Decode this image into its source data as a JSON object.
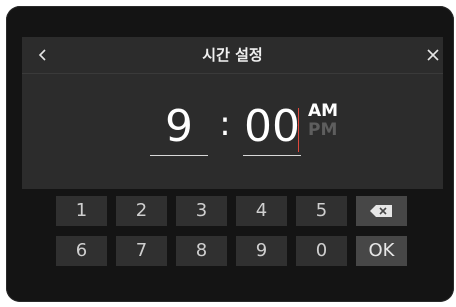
{
  "header": {
    "title": "시간 설정",
    "back_icon": "chevron-left-icon",
    "close_icon": "close-icon"
  },
  "time": {
    "hour": "9",
    "separator": ":",
    "minute": "00",
    "am_label": "AM",
    "pm_label": "PM",
    "selected_period": "AM"
  },
  "keypad": {
    "row1": [
      "1",
      "2",
      "3",
      "4",
      "5"
    ],
    "backspace_icon": "backspace-icon",
    "row2": [
      "6",
      "7",
      "8",
      "9",
      "0"
    ],
    "ok_label": "OK"
  },
  "colors": {
    "background": "#141414",
    "panel": "#2c2c2c",
    "key": "#303030",
    "func_key": "#474747",
    "cursor": "#e0483c",
    "inactive_text": "#5e5e5e"
  }
}
